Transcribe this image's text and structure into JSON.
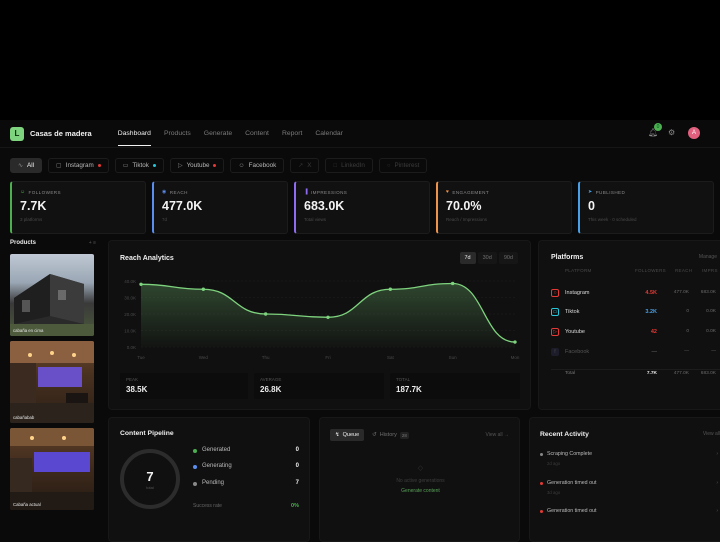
{
  "app": {
    "brand_initial": "L",
    "brand_name": "Casas de madera",
    "accent": "#7ed37e",
    "nav": [
      "Dashboard",
      "Products",
      "Generate",
      "Content",
      "Report",
      "Calendar"
    ],
    "notifications": "0",
    "avatar_initial": "A"
  },
  "filters": [
    {
      "label": "All",
      "icon": "activity-icon",
      "active": true
    },
    {
      "label": "Instagram",
      "icon": "instagram-icon",
      "dot": "#e53935"
    },
    {
      "label": "Tiktok",
      "icon": "tiktok-icon",
      "dot": "#26c6da"
    },
    {
      "label": "Youtube",
      "icon": "youtube-icon",
      "dot": "#e53935"
    },
    {
      "label": "Facebook",
      "icon": "users-icon"
    },
    {
      "label": "X",
      "icon": "x-icon",
      "dim": true
    },
    {
      "label": "LinkedIn",
      "icon": "linkedin-icon",
      "dim": true
    },
    {
      "label": "Pinterest",
      "icon": "pinterest-icon",
      "dim": true
    }
  ],
  "metrics": [
    {
      "label": "FOLLOWERS",
      "value": "7.7K",
      "sub": "3 platforms",
      "color": "#4caf50",
      "icon": "users-icon"
    },
    {
      "label": "REACH",
      "value": "477.0K",
      "sub": "7d",
      "color": "#5b8def",
      "icon": "eye-icon"
    },
    {
      "label": "IMPRESSIONS",
      "value": "683.0K",
      "sub": "Total views",
      "color": "#8e6cf0",
      "icon": "bar-chart-icon"
    },
    {
      "label": "ENGAGEMENT",
      "value": "70.0%",
      "sub": "Reach / Impressions",
      "color": "#f0934a",
      "icon": "heart-icon"
    },
    {
      "label": "PUBLISHED",
      "value": "0",
      "sub": "This week · 0 scheduled",
      "color": "#4aa0e6",
      "icon": "send-icon"
    }
  ],
  "products": {
    "title": "Products",
    "items": [
      {
        "caption": "cabaña en cima"
      },
      {
        "caption": "cabañabab"
      },
      {
        "caption": "Cabaña actual"
      }
    ]
  },
  "reach": {
    "title": "Reach Analytics",
    "ranges": [
      "7d",
      "30d",
      "90d"
    ],
    "active_range": "7d",
    "stats": [
      {
        "label": "PEAK",
        "value": "38.5K"
      },
      {
        "label": "AVERAGE",
        "value": "26.8K"
      },
      {
        "label": "TOTAL",
        "value": "187.7K"
      }
    ]
  },
  "chart_data": {
    "type": "area",
    "title": "Reach Analytics",
    "categories": [
      "Tue",
      "Wed",
      "Thu",
      "Fri",
      "Sat",
      "Sun",
      "Mon"
    ],
    "values": [
      38000,
      35000,
      20000,
      18000,
      35000,
      38500,
      3000
    ],
    "ylim": [
      0,
      40000
    ],
    "yticks": [
      "40.0K",
      "30.0K",
      "20.0K",
      "10.0K",
      "0.0K"
    ],
    "grid": true,
    "color": "#7ed37e"
  },
  "platforms": {
    "title": "Platforms",
    "manage": "Manage",
    "headers": [
      "PLATFORM",
      "FOLLOWERS",
      "REACH",
      "IMPRS"
    ],
    "rows": [
      {
        "name": "Instagram",
        "followers": "4.5K",
        "reach": "477.0K",
        "imprs": "683.0K",
        "color": "#e53935",
        "icon": "instagram-icon"
      },
      {
        "name": "Tiktok",
        "followers": "3.2K",
        "reach": "0",
        "imprs": "0.0K",
        "color": "#4aa0e6",
        "icon": "tiktok-icon"
      },
      {
        "name": "Youtube",
        "followers": "42",
        "reach": "0",
        "imprs": "0.0K",
        "color": "#e53935",
        "icon": "youtube-icon"
      },
      {
        "name": "Facebook",
        "followers": "—",
        "reach": "—",
        "imprs": "—",
        "color": "#555555",
        "icon": "facebook-icon"
      }
    ],
    "total": {
      "label": "Total",
      "followers": "7.7K",
      "reach": "477.0K",
      "imprs": "683.0K"
    }
  },
  "pipeline": {
    "title": "Content Pipeline",
    "total": "7",
    "total_label": "total",
    "rows": [
      {
        "label": "Generated",
        "value": "0",
        "color": "#4caf50"
      },
      {
        "label": "Generating",
        "value": "0",
        "color": "#5b8def"
      },
      {
        "label": "Pending",
        "value": "7",
        "color": "#888888"
      }
    ],
    "success_label": "Success rate",
    "success_value": "0%"
  },
  "queue": {
    "tabs": [
      {
        "label": "Queue",
        "icon": "zap-icon"
      },
      {
        "label": "History",
        "icon": "history-icon",
        "badge": "28"
      }
    ],
    "view_all": "View all",
    "empty_text": "No active generations",
    "empty_action": "Generate content"
  },
  "activity": {
    "title": "Recent Activity",
    "view_all": "View all",
    "items": [
      {
        "text": "Scraping Complete",
        "time": "2d ago",
        "color": "#888888"
      },
      {
        "text": "Generation timed out",
        "time": "3d ago",
        "color": "#e53935"
      },
      {
        "text": "Generation timed out",
        "time": "",
        "color": "#e53935"
      }
    ]
  }
}
